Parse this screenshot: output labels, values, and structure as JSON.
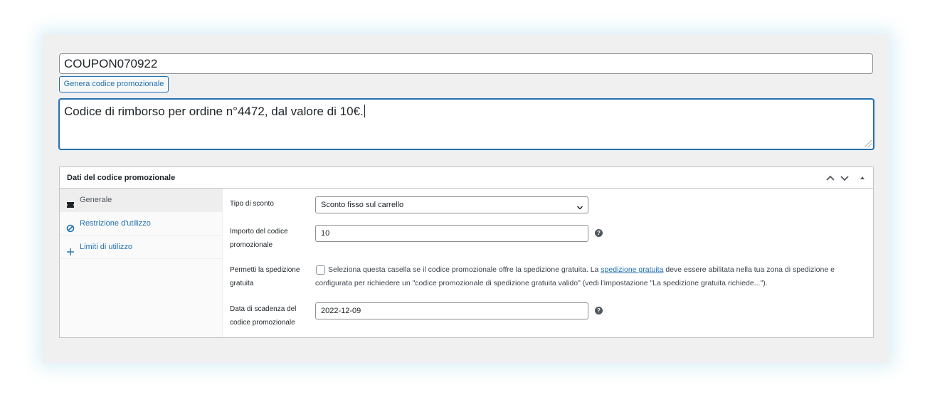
{
  "coupon": {
    "code": "COUPON070922",
    "generate_button": "Genera codice promozionale",
    "description": "Codice di rimborso per ordine n°4472, dal valore di 10€."
  },
  "metabox": {
    "title": "Dati del codice promozionale",
    "tabs": [
      {
        "label": "Generale",
        "icon": "ticket-icon",
        "active": true
      },
      {
        "label": "Restrizione d'utilizzo",
        "icon": "block-icon",
        "active": false
      },
      {
        "label": "Limiti di utilizzo",
        "icon": "plus-icon",
        "active": false
      }
    ],
    "fields": {
      "discount_type_label": "Tipo di sconto",
      "discount_type_value": "Sconto fisso sul carrello",
      "amount_label": "Importo del codice promozionale",
      "amount_value": "10",
      "free_shipping_label": "Permetti la spedizione gratuita",
      "free_shipping_desc_before": "Seleziona questa casella se il codice promozionale offre la spedizione gratuita. La ",
      "free_shipping_link": "spedizione gratuita",
      "free_shipping_desc_after": " deve essere abilitata nella tua zona di spedizione e configurata per richiedere un \"codice promozionale di spedizione gratuita valido\" (vedi l'impostazione \"La spedizione gratuita richiede...\").",
      "expiry_label": "Data di scadenza del codice promozionale",
      "expiry_value": "2022-12-09"
    },
    "help_icon_glyph": "?"
  },
  "colors": {
    "accent": "#2271b1",
    "background": "#f0f0f1",
    "border": "#c3c4c7"
  }
}
